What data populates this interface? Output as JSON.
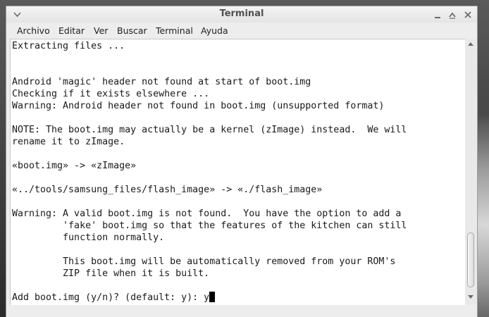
{
  "window": {
    "title": "Terminal",
    "controls": [
      "minimize-icon",
      "maximize-icon",
      "close-icon"
    ],
    "menu_icon": "chevron-down-icon"
  },
  "menubar": {
    "items": [
      "Archivo",
      "Editar",
      "Ver",
      "Buscar",
      "Terminal",
      "Ayuda"
    ]
  },
  "terminal": {
    "lines": [
      "Extracting files ...",
      "",
      "",
      "Android 'magic' header not found at start of boot.img",
      "Checking if it exists elsewhere ...",
      "Warning: Android header not found in boot.img (unsupported format)",
      "",
      "NOTE: The boot.img may actually be a kernel (zImage) instead.  We will",
      "rename it to zImage.",
      "",
      "«boot.img» -> «zImage»",
      "",
      "«../tools/samsung_files/flash_image» -> «./flash_image»",
      "",
      "Warning: A valid boot.img is not found.  You have the option to add a",
      "         'fake' boot.img so that the features of the kitchen can still",
      "         function normally.",
      "",
      "         This boot.img will be automatically removed from your ROM's",
      "         ZIP file when it is built.",
      "",
      "Add boot.img (y/n)? (default: y): y"
    ]
  },
  "colors": {
    "terminal_bg": "#ffffff",
    "terminal_fg": "#1a1a1a",
    "chrome": "#ededed",
    "title": "#505050"
  }
}
